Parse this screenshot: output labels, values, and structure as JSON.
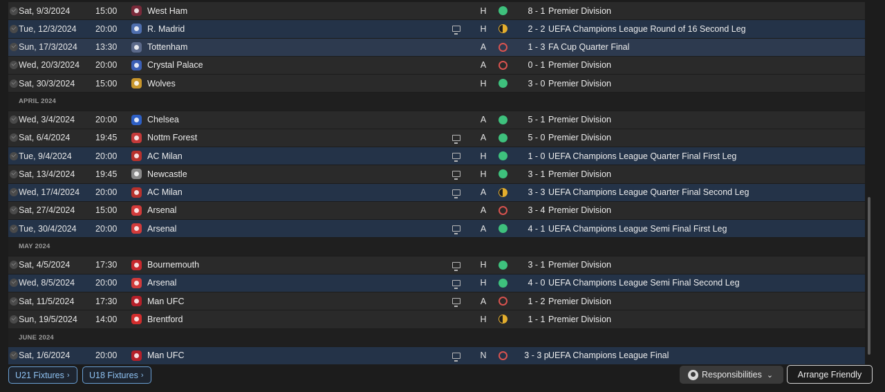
{
  "rows": [
    {
      "kind": "match",
      "style": "league",
      "date": "Sat, 9/3/2024",
      "time": "15:00",
      "opponent": "West Ham",
      "crest_color": "#7a2a3a",
      "tv": false,
      "venue": "H",
      "result": "W",
      "score": "8 - 1",
      "competition": "Premier Division"
    },
    {
      "kind": "match",
      "style": "euro",
      "date": "Tue, 12/3/2024",
      "time": "20:00",
      "opponent": "R. Madrid",
      "crest_color": "#4f6fae",
      "tv": true,
      "venue": "H",
      "result": "D",
      "score": "2 - 2",
      "competition": "UEFA Champions League Round of 16 Second Leg"
    },
    {
      "kind": "match",
      "style": "cup",
      "date": "Sun, 17/3/2024",
      "time": "13:30",
      "opponent": "Tottenham",
      "crest_color": "#5c6a8a",
      "tv": false,
      "venue": "A",
      "result": "L",
      "score": "1 - 3",
      "competition": "FA Cup Quarter Final"
    },
    {
      "kind": "match",
      "style": "league",
      "date": "Wed, 20/3/2024",
      "time": "20:00",
      "opponent": "Crystal Palace",
      "crest_color": "#3b5fb5",
      "tv": false,
      "venue": "A",
      "result": "L",
      "score": "0 - 1",
      "competition": "Premier Division"
    },
    {
      "kind": "match",
      "style": "league",
      "date": "Sat, 30/3/2024",
      "time": "15:00",
      "opponent": "Wolves",
      "crest_color": "#c9962b",
      "tv": false,
      "venue": "H",
      "result": "W",
      "score": "3 - 0",
      "competition": "Premier Division"
    },
    {
      "kind": "month",
      "label": "APRIL 2024"
    },
    {
      "kind": "match",
      "style": "league",
      "date": "Wed, 3/4/2024",
      "time": "20:00",
      "opponent": "Chelsea",
      "crest_color": "#2d5fc4",
      "tv": false,
      "venue": "A",
      "result": "W",
      "score": "5 - 1",
      "competition": "Premier Division"
    },
    {
      "kind": "match",
      "style": "league",
      "date": "Sat, 6/4/2024",
      "time": "19:45",
      "opponent": "Nottm Forest",
      "crest_color": "#c43a3a",
      "tv": true,
      "venue": "A",
      "result": "W",
      "score": "5 - 0",
      "competition": "Premier Division"
    },
    {
      "kind": "match",
      "style": "euro",
      "date": "Tue, 9/4/2024",
      "time": "20:00",
      "opponent": "AC Milan",
      "crest_color": "#b8322d",
      "tv": true,
      "venue": "H",
      "result": "W",
      "score": "1 - 0",
      "competition": "UEFA Champions League Quarter Final First Leg"
    },
    {
      "kind": "match",
      "style": "league",
      "date": "Sat, 13/4/2024",
      "time": "19:45",
      "opponent": "Newcastle",
      "crest_color": "#8a8a8a",
      "tv": true,
      "venue": "H",
      "result": "W",
      "score": "3 - 1",
      "competition": "Premier Division"
    },
    {
      "kind": "match",
      "style": "euro",
      "date": "Wed, 17/4/2024",
      "time": "20:00",
      "opponent": "AC Milan",
      "crest_color": "#b8322d",
      "tv": true,
      "venue": "A",
      "result": "D",
      "score": "3 - 3",
      "competition": "UEFA Champions League Quarter Final Second Leg"
    },
    {
      "kind": "match",
      "style": "league",
      "date": "Sat, 27/4/2024",
      "time": "15:00",
      "opponent": "Arsenal",
      "crest_color": "#d23b3b",
      "tv": false,
      "venue": "A",
      "result": "L",
      "score": "3 - 4",
      "competition": "Premier Division"
    },
    {
      "kind": "match",
      "style": "euro",
      "date": "Tue, 30/4/2024",
      "time": "20:00",
      "opponent": "Arsenal",
      "crest_color": "#d23b3b",
      "tv": true,
      "venue": "A",
      "result": "W",
      "score": "4 - 1",
      "competition": "UEFA Champions League Semi Final First Leg"
    },
    {
      "kind": "month",
      "label": "MAY 2024"
    },
    {
      "kind": "match",
      "style": "league",
      "date": "Sat, 4/5/2024",
      "time": "17:30",
      "opponent": "Bournemouth",
      "crest_color": "#c8282d",
      "tv": true,
      "venue": "H",
      "result": "W",
      "score": "3 - 1",
      "competition": "Premier Division"
    },
    {
      "kind": "match",
      "style": "euro",
      "date": "Wed, 8/5/2024",
      "time": "20:00",
      "opponent": "Arsenal",
      "crest_color": "#d23b3b",
      "tv": true,
      "venue": "H",
      "result": "W",
      "score": "4 - 0",
      "competition": "UEFA Champions League Semi Final Second Leg"
    },
    {
      "kind": "match",
      "style": "league",
      "date": "Sat, 11/5/2024",
      "time": "17:30",
      "opponent": "Man UFC",
      "crest_color": "#b5202a",
      "tv": true,
      "venue": "A",
      "result": "L",
      "score": "1 - 2",
      "competition": "Premier Division"
    },
    {
      "kind": "match",
      "style": "league",
      "date": "Sun, 19/5/2024",
      "time": "14:00",
      "opponent": "Brentford",
      "crest_color": "#d22d2d",
      "tv": false,
      "venue": "H",
      "result": "D",
      "score": "1 - 1",
      "competition": "Premier Division"
    },
    {
      "kind": "month",
      "label": "JUNE 2024"
    },
    {
      "kind": "match",
      "style": "euro",
      "date": "Sat, 1/6/2024",
      "time": "20:00",
      "opponent": "Man UFC",
      "crest_color": "#b5202a",
      "tv": true,
      "venue": "N",
      "result": "L",
      "score": "3 - 3 p",
      "competition": "UEFA Champions League Final"
    }
  ],
  "buttons": {
    "u21": "U21 Fixtures",
    "u18": "U18 Fixtures",
    "chevron": "›",
    "responsibilities": "Responsibilities",
    "responsibilities_dropdown": "⌄",
    "arrange_friendly": "Arrange Friendly"
  },
  "colors": {
    "win": "#3ec17d",
    "loss": "#d9534f",
    "draw": "#e3ad2d",
    "accent": "#6aa0d6"
  }
}
